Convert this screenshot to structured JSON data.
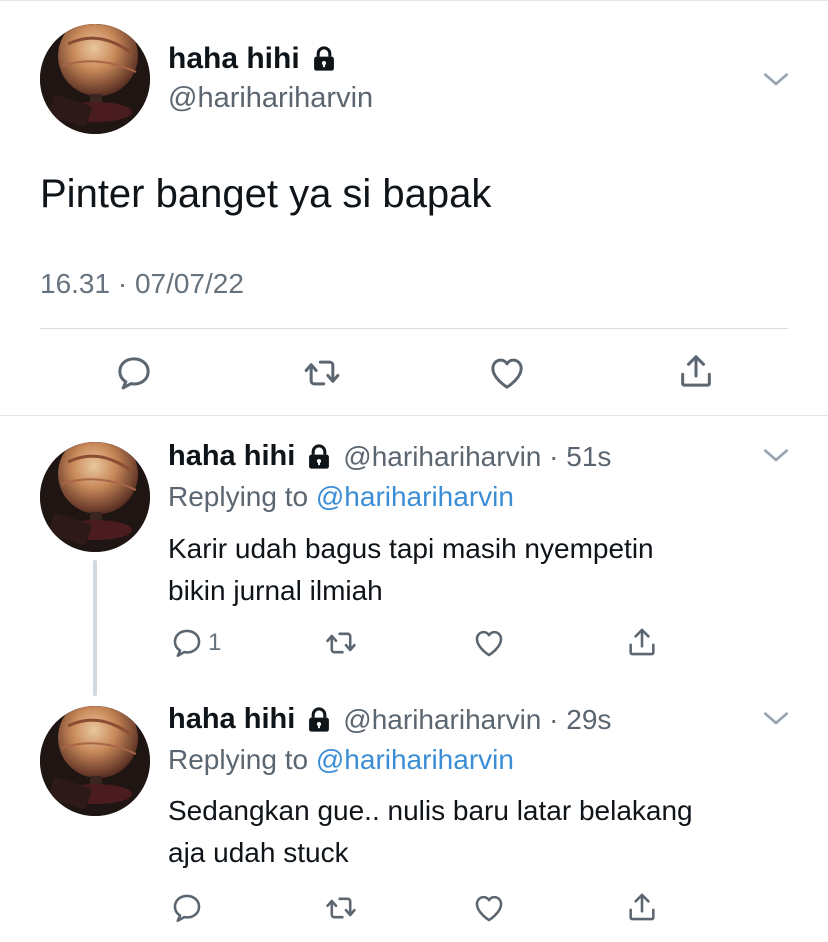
{
  "main_tweet": {
    "display_name": "haha hihi",
    "handle": "@harihariharvin",
    "text": "Pinter banget ya si bapak",
    "meta": "16.31 · 07/07/22",
    "icons": {
      "lock": "lock-icon",
      "more": "chevron-down-icon",
      "reply": "reply-icon",
      "retweet": "retweet-icon",
      "like": "heart-icon",
      "share": "share-icon"
    }
  },
  "replies": [
    {
      "display_name": "haha hihi",
      "handle_time": "@harihariharvin · 51s",
      "replying_prefix": "Replying to",
      "replying_to": "@harihariharvin",
      "text_line1": "Karir udah bagus tapi masih nyempetin",
      "text_line2": "bikin jurnal ilmiah",
      "reply_count": "1"
    },
    {
      "display_name": "haha hihi",
      "handle_time": "@harihariharvin · 29s",
      "replying_prefix": "Replying to",
      "replying_to": "@harihariharvin",
      "text_line1": "Sedangkan gue.. nulis baru latar belakang",
      "text_line2": "aja udah stuck",
      "reply_count": ""
    }
  ],
  "colors": {
    "text": "#0f1419",
    "secondary": "#5b6670",
    "link": "#3b8ed6",
    "divider": "#d8dde1"
  }
}
